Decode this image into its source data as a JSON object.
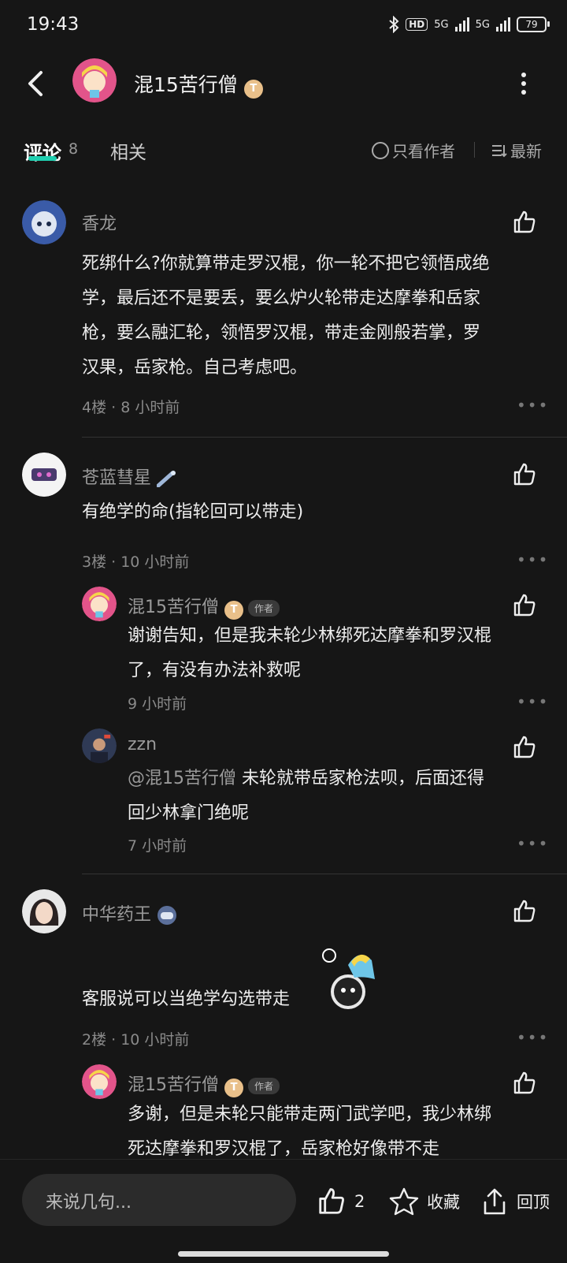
{
  "status_bar": {
    "time": "19:43",
    "network1": "5G",
    "network2": "5G",
    "battery": "79",
    "hd": "HD"
  },
  "header": {
    "title": "混15苦行僧",
    "badge": "T"
  },
  "tabs": {
    "comments_label": "评论",
    "comments_count": "8",
    "related_label": "相关",
    "only_author": "只看作者",
    "sort": "最新"
  },
  "author_tag": "作者",
  "comments": [
    {
      "user": "香龙",
      "text_lines": [
        "死绑什么?你就算带走罗汉棍，你一轮不把它领悟成绝",
        "学，最后还不是要丢，要么炉火轮带走达摩拳和岳家",
        "枪，要么融汇轮，领悟罗汉棍，带走金刚般若掌，罗",
        "汉果，岳家枪。自己考虑吧。"
      ],
      "floor": "4楼",
      "time": "8 小时前"
    },
    {
      "user": "苍蓝彗星",
      "text_lines": [
        "有绝学的命(指轮回可以带走)"
      ],
      "floor": "3楼",
      "time": "10 小时前"
    },
    {
      "user": "中华药王",
      "text_lines": [
        "客服说可以当绝学勾选带走"
      ],
      "floor": "2楼",
      "time": "10 小时前"
    }
  ],
  "replies": [
    {
      "user": "混15苦行僧",
      "text_lines": [
        "谢谢告知，但是我未轮少林绑死达摩拳和罗汉棍",
        "了，有没有办法补救呢"
      ],
      "time": "9 小时前"
    },
    {
      "user": "zzn",
      "mention": "@混15苦行僧",
      "text_lines": [
        "未轮就带岳家枪法呗，后面还得",
        "回少林拿门绝呢"
      ],
      "time": "7 小时前"
    },
    {
      "user": "混15苦行僧",
      "text_lines": [
        "多谢，但是未轮只能带走两门武学吧，我少林绑",
        "死达摩拳和罗汉棍了，岳家枪好像带不走"
      ]
    }
  ],
  "bottom_bar": {
    "input_placeholder": "来说几句...",
    "like_count": "2",
    "collect_label": "收藏",
    "top_label": "回顶"
  }
}
